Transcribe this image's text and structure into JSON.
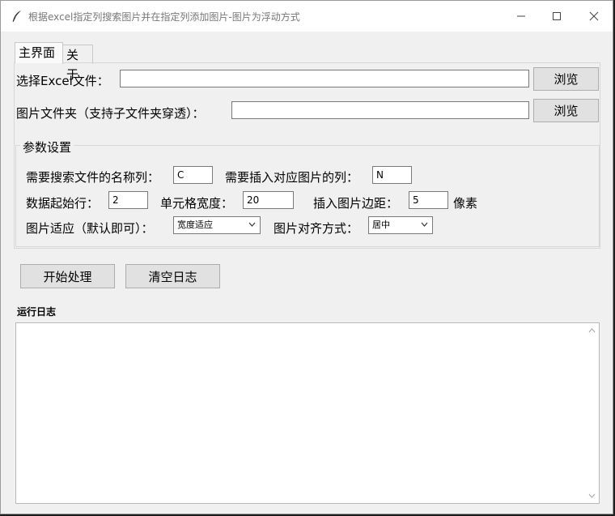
{
  "window": {
    "title": "根据excel指定列搜索图片并在指定列添加图片-图片为浮动方式"
  },
  "tabs": [
    {
      "label": "主界面"
    },
    {
      "label": "关于"
    }
  ],
  "main": {
    "excel_label": "选择Excel文件：",
    "excel_value": "",
    "browse_label": "浏览",
    "folder_label": "图片文件夹（支持子文件夹穿透）：",
    "folder_value": "",
    "params": {
      "title": "参数设置",
      "search_col_label": "需要搜索文件的名称列：",
      "search_col_value": "C",
      "insert_col_label": "需要插入对应图片的列：",
      "insert_col_value": "N",
      "start_row_label": "数据起始行：",
      "start_row_value": "2",
      "cell_width_label": "单元格宽度：",
      "cell_width_value": "20",
      "margin_label": "插入图片边距：",
      "margin_value": "5",
      "margin_unit": "像素",
      "fit_label": "图片适应（默认即可）：",
      "fit_value": "宽度适应",
      "align_label": "图片对齐方式：",
      "align_value": "居中"
    },
    "start_button": "开始处理",
    "clear_button": "清空日志",
    "log_title": "运行日志"
  }
}
